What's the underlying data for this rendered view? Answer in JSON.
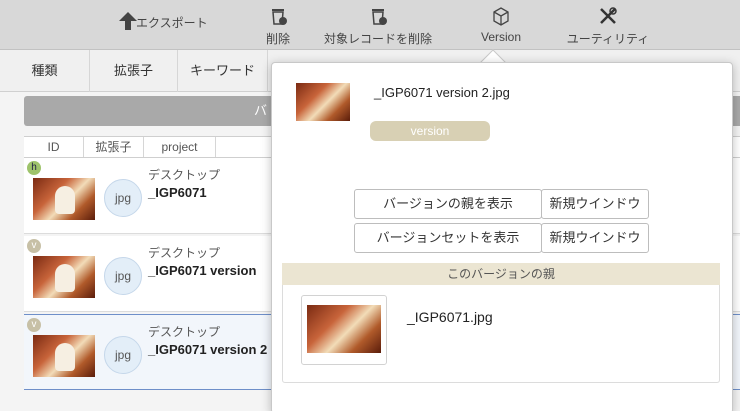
{
  "toolbar": {
    "export": "エクスポート",
    "delete": "削除",
    "delete_records": "対象レコードを削除",
    "version": "Version",
    "utility": "ユーティリティ"
  },
  "filterbar": {
    "kind": "種類",
    "extension": "拡張子",
    "keyword": "キーワード"
  },
  "list": {
    "header_fragment": "バ",
    "columns": [
      "ID",
      "拡張子",
      "project"
    ],
    "rows": [
      {
        "badge": "h",
        "ext": "jpg",
        "location": "デスクトップ",
        "name": "_IGP6071"
      },
      {
        "badge": "v",
        "ext": "jpg",
        "location": "デスクトップ",
        "name": "_IGP6071 version"
      },
      {
        "badge": "v",
        "ext": "jpg",
        "location": "デスクトップ",
        "name": "_IGP6071 version 2"
      }
    ]
  },
  "popover": {
    "title": "_IGP6071 version 2.jpg",
    "tag": "version",
    "show_parent": "バージョンの親を表示",
    "show_set": "バージョンセットを表示",
    "new_window": "新規ウインドウ",
    "section_title": "このバージョンの親",
    "parent_name": "_IGP6071.jpg"
  },
  "colors": {
    "toolbar_bg": "#d8d8d8",
    "selection_border": "#6e8fc9",
    "tag_bg": "#d8d0b4",
    "section_bg": "#ebe5d2"
  }
}
